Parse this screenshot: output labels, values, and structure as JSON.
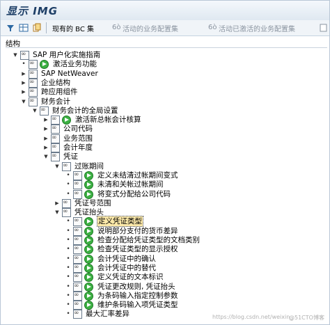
{
  "window": {
    "title": "显示 IMG"
  },
  "toolbar": {
    "bc_sets": "现有的 BC 集",
    "active_business_config_sets": "活动的业务配置集",
    "activated_business_config_sets": "活动已激活的业务配置集"
  },
  "section_label": "结构",
  "tree": [
    {
      "label": "SAP 用户化实施指南",
      "expanded": true,
      "exec": false
    },
    {
      "label": "激活业务功能",
      "expanded": null,
      "exec": true
    },
    {
      "label": "SAP NetWeaver",
      "expanded": false,
      "exec": false
    },
    {
      "label": "企业结构",
      "expanded": false,
      "exec": false
    },
    {
      "label": "跨应用组件",
      "expanded": false,
      "exec": false
    },
    {
      "label": "财务会计",
      "expanded": true,
      "exec": false
    },
    {
      "label": "财务会计的全局设置",
      "expanded": true,
      "exec": false
    },
    {
      "label": "激活新总帐会计核算",
      "expanded": false,
      "exec": true
    },
    {
      "label": "公司代码",
      "expanded": false,
      "exec": false
    },
    {
      "label": "业务范围",
      "expanded": false,
      "exec": false
    },
    {
      "label": "会计年度",
      "expanded": false,
      "exec": false
    },
    {
      "label": "凭证",
      "expanded": true,
      "exec": false
    },
    {
      "label": "过账期间",
      "expanded": true,
      "exec": false
    },
    {
      "label": "定义未结清过帐期间变式",
      "expanded": null,
      "exec": true
    },
    {
      "label": "未清和关帐过帐期间",
      "expanded": null,
      "exec": true
    },
    {
      "label": "将变式分配给公司代码",
      "expanded": null,
      "exec": true
    },
    {
      "label": "凭证号范围",
      "expanded": false,
      "exec": false
    },
    {
      "label": "凭证抬头",
      "expanded": true,
      "exec": false
    },
    {
      "label": "定义凭证类型",
      "expanded": null,
      "exec": true,
      "selected": true
    },
    {
      "label": "说明部分支付的货币差异",
      "expanded": null,
      "exec": true
    },
    {
      "label": "检查分配给凭证类型的文档类别",
      "expanded": null,
      "exec": true
    },
    {
      "label": "检查凭证类型的显示授权",
      "expanded": null,
      "exec": true
    },
    {
      "label": "会计凭证中的确认",
      "expanded": null,
      "exec": true
    },
    {
      "label": "会计凭证中的替代",
      "expanded": null,
      "exec": true
    },
    {
      "label": "定义凭证的文本标识",
      "expanded": null,
      "exec": true
    },
    {
      "label": "凭证更改规则, 凭证抬头",
      "expanded": null,
      "exec": true
    },
    {
      "label": "为条码输入指定控制参数",
      "expanded": null,
      "exec": true
    },
    {
      "label": "维护条码输入项凭证类型",
      "expanded": null,
      "exec": true
    },
    {
      "label": "最大汇率差异",
      "expanded": null,
      "exec": false
    }
  ],
  "watermark": {
    "left": "https://blog.csdn.net/weixin_",
    "right": "@51CTO博客"
  }
}
